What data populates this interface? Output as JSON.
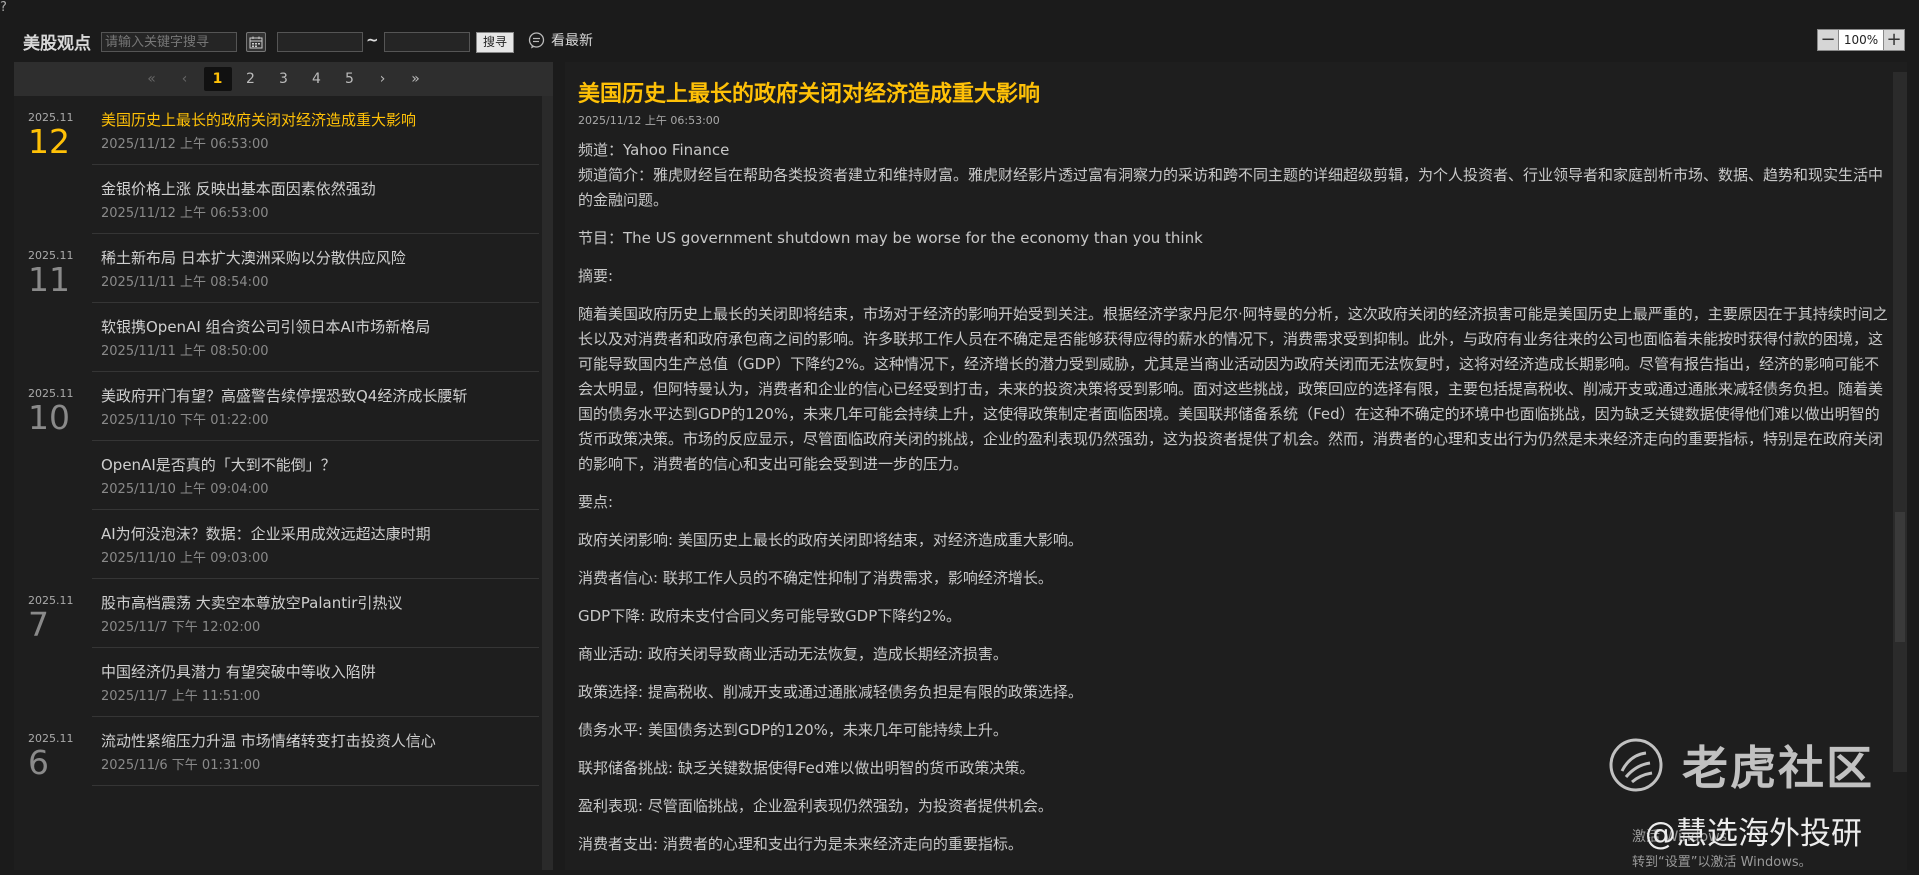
{
  "header": {
    "corner": "?",
    "title": "美股观点",
    "search_placeholder": "请输入关键字搜寻",
    "date_separator": "~",
    "search_button": "搜寻",
    "latest_label": "看最新",
    "zoom_level": "100%",
    "zoom_minus": "−",
    "zoom_plus": "+"
  },
  "pager": {
    "first": "«",
    "prev": "‹",
    "pages": [
      "1",
      "2",
      "3",
      "4",
      "5"
    ],
    "active_page": "1",
    "next": "›",
    "last": "»"
  },
  "news": [
    {
      "month": "2025.11",
      "day": "12",
      "title": "美国历史上最长的政府关闭对经济造成重大影响",
      "time": "2025/11/12 上午 06:53:00",
      "active": true
    },
    {
      "month": "",
      "day": "",
      "title": "金银价格上涨 反映出基本面因素依然强劲",
      "time": "2025/11/12 上午 06:53:00"
    },
    {
      "month": "2025.11",
      "day": "11",
      "title": "稀土新布局 日本扩大澳洲采购以分散供应风险",
      "time": "2025/11/11 上午 08:54:00"
    },
    {
      "month": "",
      "day": "",
      "title": "软银携OpenAI 组合资公司引领日本AI市场新格局",
      "time": "2025/11/11 上午 08:50:00"
    },
    {
      "month": "2025.11",
      "day": "10",
      "title": "美政府开门有望？高盛警告续停摆恐致Q4经济成长腰斩",
      "time": "2025/11/10 下午 01:22:00"
    },
    {
      "month": "",
      "day": "",
      "title": "OpenAI是否真的「大到不能倒」？",
      "time": "2025/11/10 上午 09:04:00"
    },
    {
      "month": "",
      "day": "",
      "title": "AI为何没泡沫？数据：企业采用成效远超达康时期",
      "time": "2025/11/10 上午 09:03:00"
    },
    {
      "month": "2025.11",
      "day": "7",
      "title": "股市高档震荡 大卖空本尊放空Palantir引热议",
      "time": "2025/11/7 下午 12:02:00"
    },
    {
      "month": "",
      "day": "",
      "title": "中国经济仍具潜力 有望突破中等收入陷阱",
      "time": "2025/11/7 上午 11:51:00"
    },
    {
      "month": "2025.11",
      "day": "6",
      "title": "流动性紧缩压力升温 市场情绪转变打击投资人信心",
      "time": "2025/11/6 下午 01:31:00"
    }
  ],
  "article": {
    "title": "美国历史上最长的政府关闭对经济造成重大影响",
    "time": "2025/11/12 上午 06:53:00",
    "channel": "频道：Yahoo Finance",
    "channel_intro": "频道简介：雅虎财经旨在帮助各类投资者建立和维持财富。雅虎财经影片透过富有洞察力的采访和跨不同主题的详细超级剪辑，为个人投资者、行业领导者和家庭剖析市场、数据、趋势和现实生活中的金融问题。",
    "program": "节目：The US government shutdown may be worse for the economy than you think",
    "summary_label": "摘要:",
    "summary": "随着美国政府历史上最长的关闭即将结束，市场对于经济的影响开始受到关注。根据经济学家丹尼尔·阿特曼的分析，这次政府关闭的经济损害可能是美国历史上最严重的，主要原因在于其持续时间之长以及对消费者和政府承包商之间的影响。许多联邦工作人员在不确定是否能够获得应得的薪水的情况下，消费需求受到抑制。此外，与政府有业务往来的公司也面临着未能按时获得付款的困境，这可能导致国内生产总值（GDP）下降约2%。这种情况下，经济增长的潜力受到威胁，尤其是当商业活动因为政府关闭而无法恢复时，这将对经济造成长期影响。尽管有报告指出，经济的影响可能不会太明显，但阿特曼认为，消费者和企业的信心已经受到打击，未来的投资决策将受到影响。面对这些挑战，政策回应的选择有限，主要包括提高税收、削减开支或通过通胀来减轻债务负担。随着美国的债务水平达到GDP的120%，未来几年可能会持续上升，这使得政策制定者面临困境。美国联邦储备系统（Fed）在这种不确定的环境中也面临挑战，因为缺乏关键数据使得他们难以做出明智的货币政策决策。市场的反应显示，尽管面临政府关闭的挑战，企业的盈利表现仍然强劲，这为投资者提供了机会。然而，消费者的心理和支出行为仍然是未来经济走向的重要指标，特别是在政府关闭的影响下，消费者的信心和支出可能会受到进一步的压力。",
    "keypoints_label": "要点:",
    "keypoints": [
      "政府关闭影响: 美国历史上最长的政府关闭即将结束，对经济造成重大影响。",
      "消费者信心: 联邦工作人员的不确定性抑制了消费需求，影响经济增长。",
      "GDP下降: 政府未支付合同义务可能导致GDP下降约2%。",
      "商业活动: 政府关闭导致商业活动无法恢复，造成长期经济损害。",
      "政策选择: 提高税收、削减开支或通过通胀减轻债务负担是有限的政策选择。",
      "债务水平: 美国债务达到GDP的120%，未来几年可能持续上升。",
      "联邦储备挑战: 缺乏关键数据使得Fed难以做出明智的货币政策决策。",
      "盈利表现: 尽管面临挑战，企业盈利表现仍然强劲，为投资者提供机会。",
      "消费者支出: 消费者的心理和支出行为是未来经济走向的重要指标。"
    ]
  },
  "watermark": {
    "brand": "老虎社区",
    "handle": "@慧选海外投研",
    "activate_line1": "激活 Windows",
    "activate_line2": "转到“设置”以激活 Windows。"
  },
  "colors": {
    "accent": "#ffc107",
    "background": "#1b1b1b",
    "panel": "#1e1e1e"
  }
}
